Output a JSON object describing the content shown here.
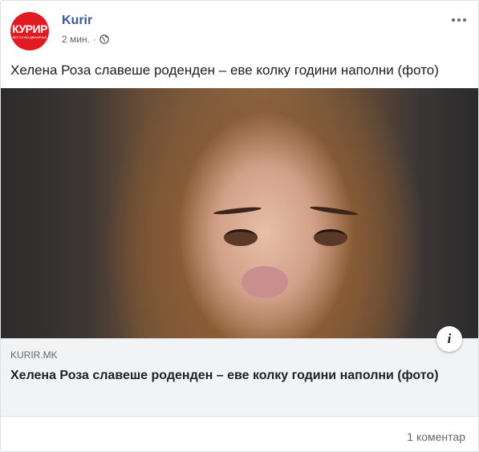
{
  "post": {
    "page_name": "Kurir",
    "avatar_text": "КУРИР",
    "avatar_subtext": "ВЕСТИ ВО ДВИЖЕЊЕ",
    "timestamp": "2 мин.",
    "separator": "·",
    "privacy_icon": "globe-icon",
    "more_icon": "more-options-icon",
    "message": "Хелена Роза славеше роденден – еве колку години наполни (фото)"
  },
  "link": {
    "domain": "KURIR.MK",
    "title": "Хелена Роза славеше роденден – еве колку години наполни (фото)",
    "info_glyph": "i"
  },
  "footer": {
    "comments": "1 коментар"
  },
  "colors": {
    "page_name": "#385898",
    "brand_red": "#e21b22",
    "link_background": "#f2f3f5"
  }
}
